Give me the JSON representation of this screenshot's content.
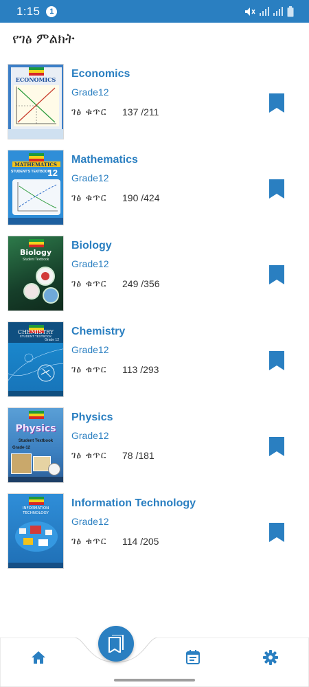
{
  "status_bar": {
    "time": "1:15",
    "notification_count": "1",
    "icons": [
      "mute-icon",
      "signal-icon",
      "signal-icon",
      "battery-icon"
    ]
  },
  "header": {
    "title": "የገፅ ምልክት"
  },
  "books": [
    {
      "name": "Economics",
      "grade": "Grade12",
      "page_label": "ገፅ ቁጥር",
      "pages": "137 /211",
      "cover_title": "ECONOMICS",
      "cover_color": "#e9eef5"
    },
    {
      "name": "Mathematics",
      "grade": "Grade12",
      "page_label": "ገፅ ቁጥር",
      "pages": "190 /424",
      "cover_title": "MATHEMATICS",
      "cover_subtitle": "STUDENT'S TEXTBOOK",
      "cover_grade": "12",
      "cover_color": "#2f8ed8"
    },
    {
      "name": "Biology",
      "grade": "Grade12",
      "page_label": "ገፅ ቁጥር",
      "pages": "249 /356",
      "cover_title": "Biology",
      "cover_subtitle": "Student Textbook",
      "cover_color": "#1f5a3a"
    },
    {
      "name": "Chemistry",
      "grade": "Grade12",
      "page_label": "ገፅ ቁጥር",
      "pages": "113 /293",
      "cover_title": "CHEMISTRY",
      "cover_subtitle": "STUDENT TEXTBOOK",
      "cover_grade": "Grade 12",
      "cover_color": "#1f86c9"
    },
    {
      "name": "Physics",
      "grade": "Grade12",
      "page_label": "ገፅ ቁጥር",
      "pages": "78 /181",
      "cover_title": "Physics",
      "cover_subtitle": "Student Textbook",
      "cover_grade": "Grade-12",
      "cover_color": "#4a8fc9"
    },
    {
      "name": "Information Technology",
      "grade": "Grade12",
      "page_label": "ገፅ ቁጥር",
      "pages": "114 /205",
      "cover_title": "INFORMATION TECHNOLOGY",
      "cover_color": "#2f8ed8"
    }
  ],
  "bottom_nav": {
    "items": [
      "home-icon",
      "bookmarks-icon",
      "calendar-icon",
      "settings-icon"
    ],
    "accent": "#2a7fc1"
  },
  "colors": {
    "primary": "#2a7fc1",
    "text": "#333333"
  }
}
